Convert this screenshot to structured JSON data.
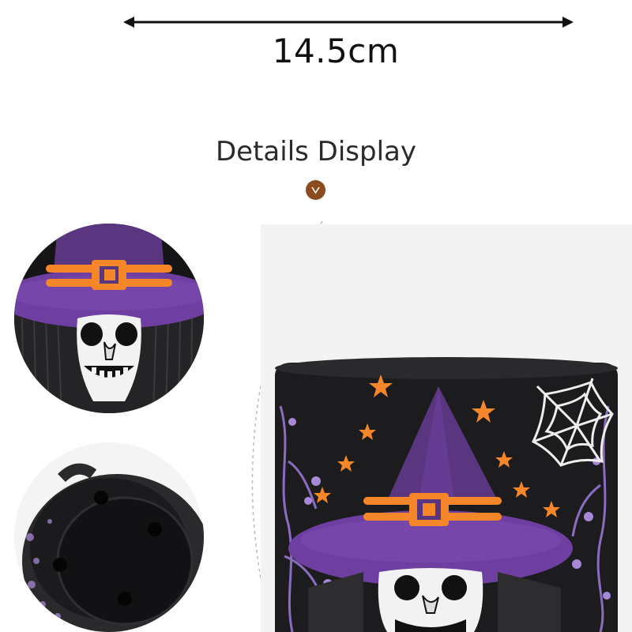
{
  "dimension": {
    "label": "14.5cm"
  },
  "section": {
    "title": "Details Display"
  },
  "colors": {
    "accent_brown": "#8B4A1F",
    "orange": "#F5872A",
    "purple": "#6E3FA0",
    "lavender": "#A788D6",
    "black": "#1C1C1E"
  },
  "icons": {
    "badge": "chevron-down-icon",
    "arrow": "double-arrow-icon"
  }
}
